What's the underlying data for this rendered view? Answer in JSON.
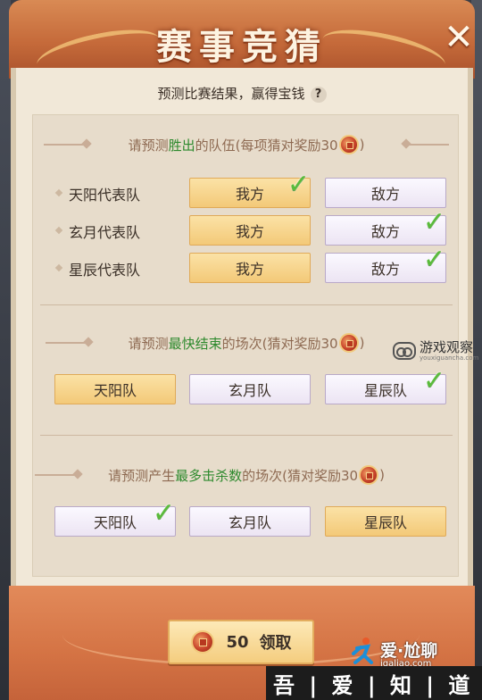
{
  "header": {
    "title": "赛事竞猜",
    "close_label": "✕"
  },
  "subtitle": {
    "text": "预测比赛结果，赢得宝钱",
    "help_label": "?"
  },
  "section1": {
    "head_pre": "请预测",
    "head_hl": "胜出",
    "head_post": "的队伍(每项猜对奖励30",
    "head_end": ")",
    "rows": [
      {
        "team": "天阳代表队",
        "opt_a": "我方",
        "opt_b": "敌方",
        "picked": "a"
      },
      {
        "team": "玄月代表队",
        "opt_a": "我方",
        "opt_b": "敌方",
        "picked": "b"
      },
      {
        "team": "星辰代表队",
        "opt_a": "我方",
        "opt_b": "敌方",
        "picked": "b"
      }
    ]
  },
  "section2": {
    "head_pre": "请预测",
    "head_hl": "最快结束",
    "head_post": "的场次(猜对奖励30",
    "head_end": ")",
    "options": [
      "天阳队",
      "玄月队",
      "星辰队"
    ],
    "picked_index": 2
  },
  "section3": {
    "head_pre": "请预测产生",
    "head_hl": "最多击杀数",
    "head_post": "的场次(猜对奖励30",
    "head_end": ")",
    "options": [
      "天阳队",
      "玄月队",
      "星辰队"
    ],
    "picked_index": 0
  },
  "claim": {
    "amount": "50",
    "label": "领取"
  },
  "watermark": {
    "text": "游戏观察",
    "sub": "youxiguancha.com"
  },
  "corner_watermark": {
    "text": "爱·尬聊",
    "url": "igaliao.com"
  },
  "bottom_strip": {
    "text": "吾 | 爱 | 知 | 道"
  },
  "colors": {
    "accent_green": "#2e8a2e",
    "check_green": "#5abb3b",
    "gold_button": "#f3c978",
    "header_orange": "#c56a3a"
  },
  "icons": {
    "close": "close-icon",
    "help": "help-icon",
    "coin": "coin-icon",
    "check": "check-icon"
  }
}
